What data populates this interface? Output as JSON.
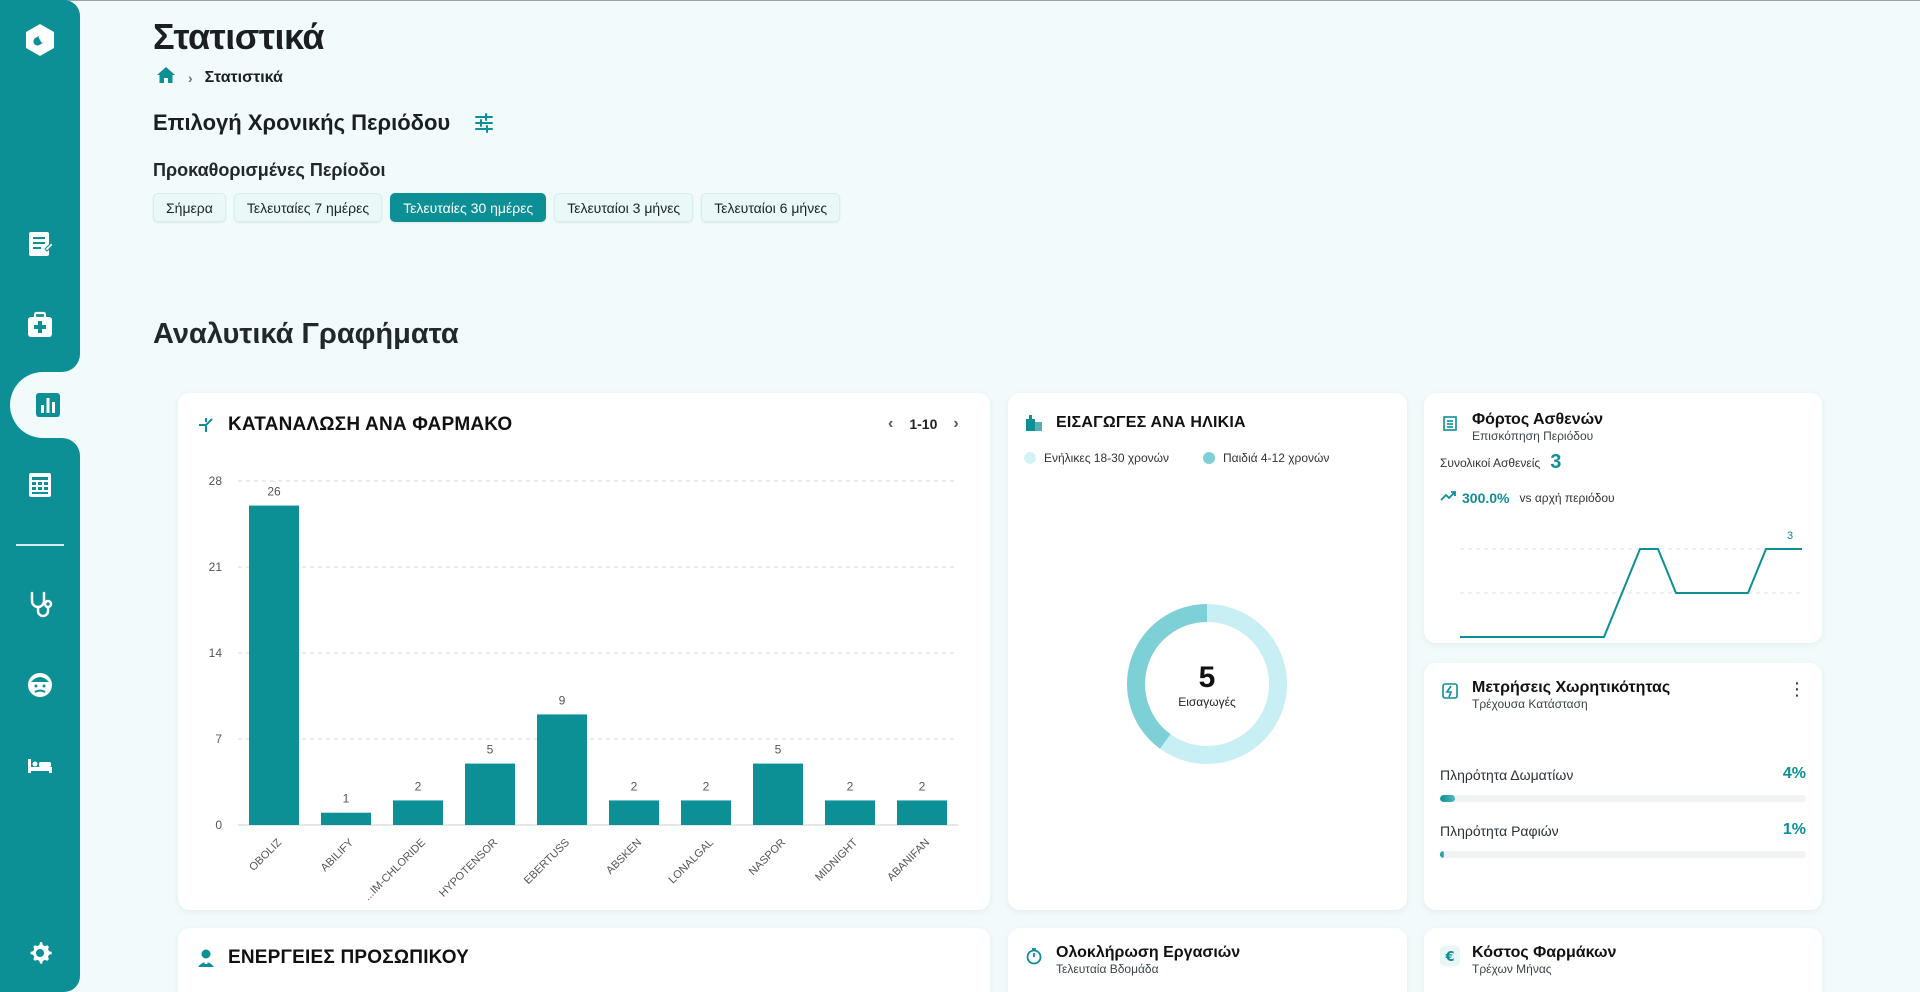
{
  "page": {
    "title": "Στατιστικά",
    "breadcrumb_current": "Στατιστικά"
  },
  "period": {
    "title": "Επιλογή Χρονικής Περιόδου",
    "presets_label": "Προκαθορισμένες Περίοδοι",
    "presets": [
      "Σήμερα",
      "Τελευταίες 7 ημέρες",
      "Τελευταίες 30 ημέρες",
      "Τελευταίοι 3 μήνες",
      "Τελευταίοι 6 μήνες"
    ],
    "active_preset": "Τελευταίες 30 ημέρες"
  },
  "analytics": {
    "title": "Αναλυτικά Γραφήματα"
  },
  "drug_card": {
    "title": "ΚΑΤΑΝΑΛΩΣΗ ΑΝΑ ΦΑΡΜΑΚΟ",
    "pager": "1-10"
  },
  "age_card": {
    "title": "ΕΙΣΑΓΩΓΕΣ ΑΝΑ ΗΛΙΚΙΑ",
    "legend": [
      "Ενήλικες 18-30 χρονών",
      "Παιδιά 4-12 χρονών"
    ],
    "total": "5",
    "total_label": "Εισαγωγές"
  },
  "load_card": {
    "title": "Φόρτος Ασθενών",
    "subtitle": "Επισκόπηση Περιόδου",
    "total_label": "Συνολικοί Ασθενείς",
    "total": "3",
    "change": "300.0%",
    "change_label": "vs αρχή περιόδου"
  },
  "capacity_card": {
    "title": "Μετρήσεις Χωρητικότητας",
    "subtitle": "Τρέχουσα Κατάσταση",
    "rooms_label": "Πληρότητα Δωματίων",
    "rooms_value": "4%",
    "shelves_label": "Πληρότητα Ραφιών",
    "shelves_value": "1%"
  },
  "staff_card": {
    "title": "ΕΝΕΡΓΕΙΕΣ ΠΡΟΣΩΠΙΚΟΥ"
  },
  "tasks_card": {
    "title": "Ολοκλήρωση Εργασιών",
    "subtitle": "Τελευταία Βδομάδα"
  },
  "cost_card": {
    "title": "Κόστος Φαρμάκων",
    "subtitle": "Τρέχων Μήνας"
  },
  "colors": {
    "primary": "#0c8f95",
    "adult_series": "#c8f0f4",
    "child_series": "#7cd0d6"
  },
  "icons": {
    "sidebar": [
      "logo-icon",
      "prescriptions-icon",
      "medicine-kit-icon",
      "statistics-icon",
      "spreadsheet-icon",
      "stethoscope-icon",
      "patient-icon",
      "bed-icon",
      "settings-icon"
    ]
  },
  "chart_data": [
    {
      "type": "bar",
      "title": "ΚΑΤΑΝΑΛΩΣΗ ΑΝΑ ΦΑΡΜΑΚΟ",
      "categories": [
        "OBOLIZ",
        "ABILIFY",
        "...IM-CHLORIDE",
        "HYPOTENSOR",
        "EBERTUSS",
        "ABSKEN",
        "LONALGAL",
        "NASPOR",
        "MIDNIGHT",
        "ABANIFAN"
      ],
      "values": [
        26,
        1,
        2,
        5,
        9,
        2,
        2,
        5,
        2,
        2
      ],
      "ylim": [
        0,
        28
      ],
      "yticks": [
        0,
        7,
        14,
        21,
        28
      ],
      "grid": true
    },
    {
      "type": "pie",
      "title": "ΕΙΣΑΓΩΓΕΣ ΑΝΑ ΗΛΙΚΙΑ",
      "labels": [
        "Ενήλικες 18-30 χρονών",
        "Παιδιά 4-12 χρονών"
      ],
      "values": [
        3,
        2
      ],
      "donut": true
    },
    {
      "type": "line",
      "title": "Φόρτος Ασθενών",
      "x": [
        0,
        1,
        2,
        3,
        4,
        5,
        6,
        7,
        8,
        9,
        10,
        11,
        12,
        13,
        14,
        15,
        16,
        17,
        18,
        19
      ],
      "values": [
        0,
        0,
        0,
        0,
        0,
        0,
        0,
        0,
        0,
        1,
        2,
        2,
        1,
        1,
        1,
        1,
        1,
        2,
        2,
        2
      ],
      "ylim": [
        0,
        3
      ],
      "last_value_label": "3"
    }
  ]
}
